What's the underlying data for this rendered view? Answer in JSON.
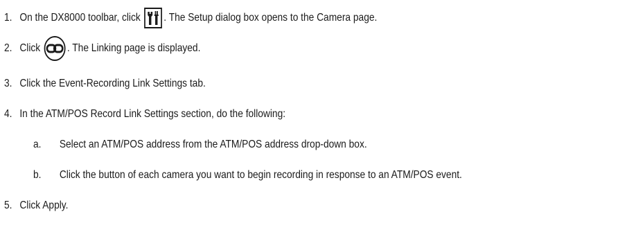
{
  "steps": [
    {
      "number": "1.",
      "before": "On the DX8000 toolbar, click",
      "icon": "setup-tools-icon",
      "after": ". The Setup dialog box opens to the Camera page."
    },
    {
      "number": "2.",
      "before": "Click",
      "icon": "linking-chain-icon",
      "after": ". The Linking page is displayed."
    },
    {
      "number": "3.",
      "text": "Click the Event-Recording Link Settings tab."
    },
    {
      "number": "4.",
      "text": "In the ATM/POS Record Link Settings section, do the following:",
      "substeps": [
        {
          "letter": "a.",
          "text": "Select an ATM/POS address from the ATM/POS address drop-down box."
        },
        {
          "letter": "b.",
          "text": "Click the button of each camera you want to begin recording in response to an ATM/POS event."
        }
      ]
    },
    {
      "number": "5.",
      "text": "Click Apply."
    }
  ]
}
